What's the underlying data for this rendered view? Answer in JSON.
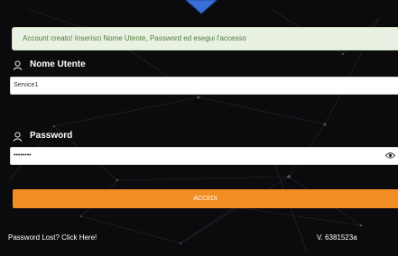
{
  "colors": {
    "background": "#0b0b0d",
    "alert_background": "#e9f1e3",
    "alert_text": "#4f7d3c",
    "accent": "#f28d24",
    "logo": "#3a6fd6"
  },
  "alert": {
    "message": "Account creato! Inserisci Nome Utente, Password ed esegui l'accesso"
  },
  "username": {
    "label": "Nome Utente",
    "icon": "user-icon",
    "value": "Service1"
  },
  "password": {
    "label": "Password",
    "icon": "user-icon",
    "value": "••••••••",
    "toggle_icon": "eye-icon"
  },
  "login": {
    "button_label": "ACCEDI"
  },
  "footer": {
    "lost_password": "Password Lost? Click Here!",
    "version": "V. 6381523a"
  }
}
